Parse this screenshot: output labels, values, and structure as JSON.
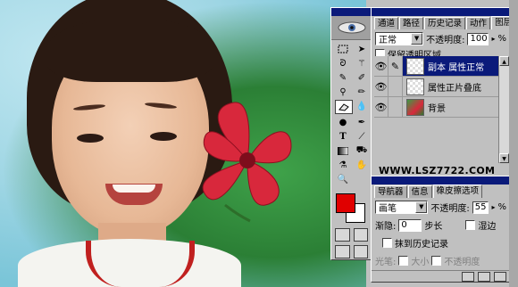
{
  "colors": {
    "title_bar": "#0a1a7a",
    "foreground_swatch": "#e00000",
    "background_swatch": "#ffffff",
    "selected_layer": "#0a1a7a"
  },
  "layers_palette": {
    "tabs": [
      "通道",
      "路径",
      "历史记录",
      "动作",
      "图层"
    ],
    "active_tab": "图层",
    "blend_mode": "正常",
    "opacity_label": "不透明度:",
    "opacity_value": "100",
    "opacity_unit": "%",
    "preserve_transparency_label": "保留透明区域",
    "layers": [
      {
        "name": "副本 属性正常",
        "selected": true,
        "visible": true,
        "thumb": "checker"
      },
      {
        "name": "属性正片叠底",
        "selected": false,
        "visible": true,
        "thumb": "checker"
      },
      {
        "name": "背景",
        "selected": false,
        "visible": true,
        "thumb": "photo"
      }
    ]
  },
  "watermark": "WWW.LSZ7722.COM",
  "options_palette": {
    "tabs": [
      "导航器",
      "信息",
      "橡皮擦选项"
    ],
    "active_tab": "橡皮擦选项",
    "mode": "画笔",
    "opacity_label": "不透明度:",
    "opacity_value": "55",
    "opacity_unit": "%",
    "fade_label": "渐隐:",
    "fade_value": "0",
    "steps_label": "步长",
    "wet_edges_label": "湿边",
    "erase_history_label": "抹到历史记录",
    "stylus_label": "光笔:",
    "size_label": "大小",
    "stylus_opacity_label": "不透明度"
  },
  "toolbox": {
    "tools": [
      "marquee-tool",
      "move-tool",
      "lasso-tool",
      "magic-wand-tool",
      "airbrush-tool",
      "paintbrush-tool",
      "rubber-stamp-tool",
      "pencil-tool",
      "eraser-tool",
      "blur-tool",
      "dodge-tool",
      "pen-tool",
      "type-tool",
      "measure-tool",
      "gradient-tool",
      "paint-bucket-tool",
      "eyedropper-tool",
      "hand-tool",
      "zoom-tool"
    ]
  }
}
